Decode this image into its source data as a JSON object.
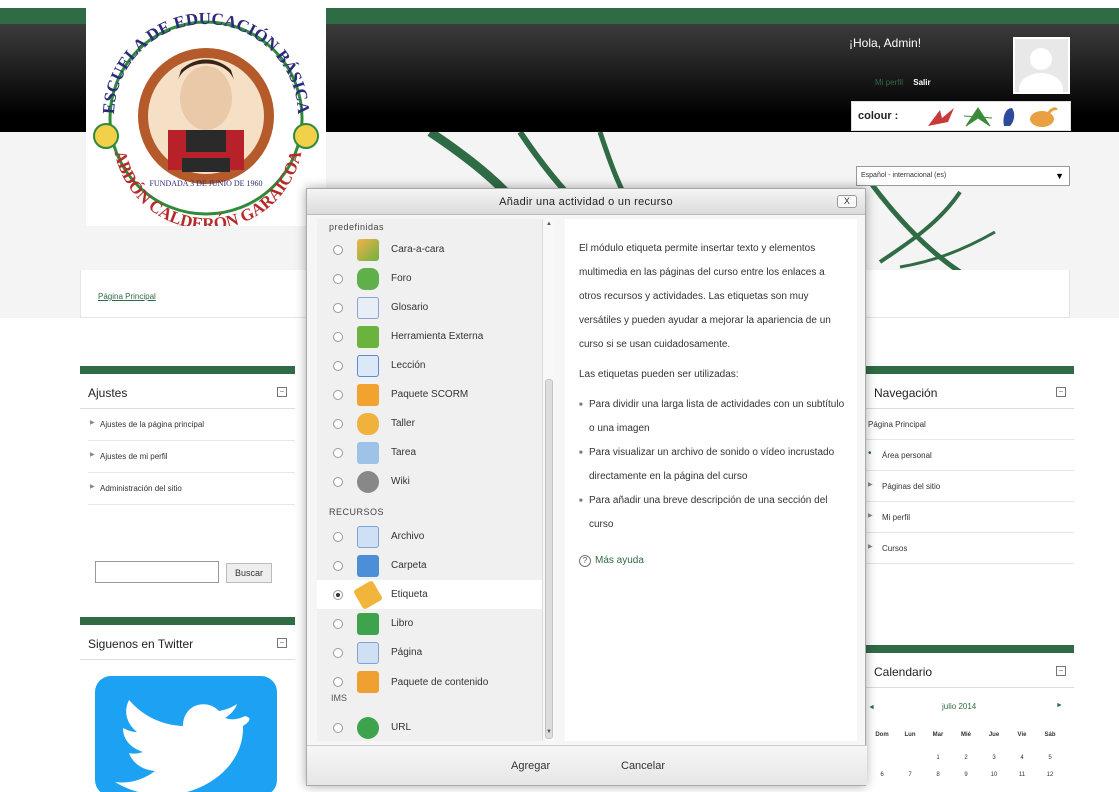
{
  "header": {
    "greeting": "¡Hola, Admin!",
    "profile_link": "Mi perfil",
    "logout_link": "Salir",
    "colour_label": "colour :",
    "language": "Español - internacional (es)"
  },
  "logo": {
    "arc_top": "ESCUELA DE EDUCACIÓN BÁSICA",
    "arc_bottom": "ABDÓN CALDERÓN GARAICOA",
    "founded": "FUNDADA 3 DE JUNIO DE 1960"
  },
  "breadcrumb": "Página Principal",
  "ajustes": {
    "title": "Ajustes",
    "items": [
      "Ajustes de la página principal",
      "Ajustes de mi perfil",
      "Administración del sitio"
    ],
    "search_button": "Buscar"
  },
  "twitter": {
    "title": "Siguenos en Twitter"
  },
  "navegacion": {
    "title": "Navegación",
    "home": "Página Principal",
    "items": [
      "Área personal",
      "Páginas del sitio",
      "Mi perfil",
      "Cursos"
    ]
  },
  "calendar": {
    "title": "Calendario",
    "month": "julio 2014",
    "prev": "◄",
    "next": "►",
    "days": [
      "Dom",
      "Lun",
      "Mar",
      "Mié",
      "Jue",
      "Vie",
      "Sáb"
    ],
    "row1": [
      "",
      "",
      "1",
      "2",
      "3",
      "4",
      "5"
    ],
    "row2": [
      "6",
      "7",
      "8",
      "9",
      "10",
      "11",
      "12"
    ]
  },
  "modal": {
    "title": "Añadir una actividad o un recurso",
    "close": "X",
    "top_category": "predefinidas",
    "activities": [
      "Cara-a-cara",
      "Foro",
      "Glosario",
      "Herramienta Externa",
      "Lección",
      "Paquete SCORM",
      "Taller",
      "Tarea",
      "Wiki"
    ],
    "resources_label": "RECURSOS",
    "resources": [
      "Archivo",
      "Carpeta",
      "Etiqueta",
      "Libro",
      "Página"
    ],
    "ims_label_1": "Paquete de contenido",
    "ims_label_2": "IMS",
    "url_label": "URL",
    "selected": "Etiqueta",
    "description": {
      "p1": "El módulo etiqueta permite insertar texto y elementos multimedia en las páginas del curso entre los enlaces a otros recursos y actividades. Las etiquetas son muy versátiles y pueden ayudar a mejorar la apariencia de un curso si se usan cuidadosamente.",
      "p2": "Las etiquetas pueden ser utilizadas:",
      "bullets": [
        "Para dividir una larga lista de actividades con un subtítulo o una imagen",
        "Para visualizar un archivo de sonido o vídeo incrustado directamente en la página del curso",
        "Para añadir una breve descripción de una sección del curso"
      ],
      "help": "Más ayuda"
    },
    "add_button": "Agregar",
    "cancel_button": "Cancelar"
  },
  "colors": {
    "theme_green": "#2f6b45",
    "twitter_blue": "#1da1f2"
  },
  "icons": {
    "colour_swatches": [
      "red-leaf-icon",
      "green-leaf-icon",
      "blue-leaf-icon",
      "orange-leaf-icon"
    ]
  }
}
